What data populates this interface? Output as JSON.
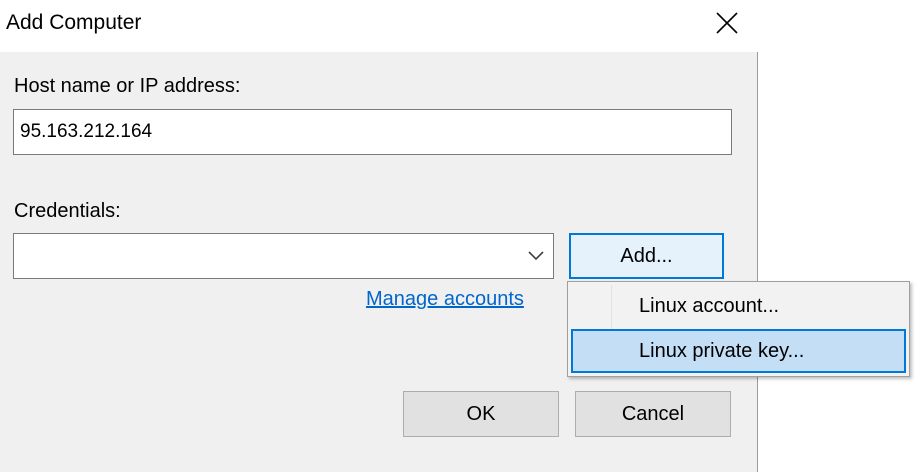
{
  "dialog": {
    "title": "Add Computer",
    "close_icon": "close-icon"
  },
  "host": {
    "label": "Host name or IP address:",
    "value": "95.163.212.164"
  },
  "credentials": {
    "label": "Credentials:",
    "selected_value": "",
    "dropdown_icon": "chevron-down-icon",
    "add_button_label": "Add...",
    "manage_link_label": "Manage accounts"
  },
  "add_menu": {
    "items": [
      {
        "label": "Linux account...",
        "highlighted": false
      },
      {
        "label": "Linux private key...",
        "highlighted": true
      }
    ]
  },
  "footer": {
    "ok_label": "OK",
    "cancel_label": "Cancel"
  },
  "colors": {
    "accent": "#0078d7",
    "link": "#0066cc",
    "menu_highlight": "#c3def5",
    "dialog_background": "#f0f0f0"
  }
}
